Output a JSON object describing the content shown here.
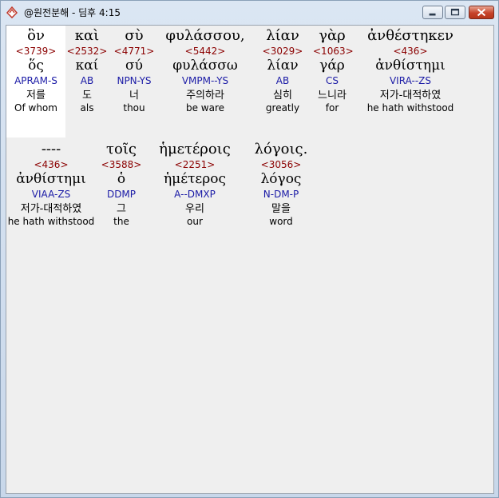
{
  "window": {
    "title": "@원전분해 - 딤후 4:15"
  },
  "rows": [
    {
      "words": [
        {
          "greek": "ὃν",
          "strong": "<3739>",
          "lemma": "ὅς",
          "parse": "APRAM-S",
          "korean": "저를",
          "english": "Of whom"
        },
        {
          "greek": "καὶ",
          "strong": "<2532>",
          "lemma": "καί",
          "parse": "AB",
          "korean": "도",
          "english": "als"
        },
        {
          "greek": "σὺ",
          "strong": "<4771>",
          "lemma": "σύ",
          "parse": "NPN-YS",
          "korean": "너",
          "english": "thou"
        },
        {
          "greek": "φυλάσσου,",
          "strong": "<5442>",
          "lemma": "φυλάσσω",
          "parse": "VMPM--YS",
          "korean": "주의하라",
          "english": "be ware"
        },
        {
          "greek": "λίαν",
          "strong": "<3029>",
          "lemma": "λίαν",
          "parse": "AB",
          "korean": "심히",
          "english": "greatly"
        },
        {
          "greek": "γὰρ",
          "strong": "<1063>",
          "lemma": "γάρ",
          "parse": "CS",
          "korean": "느니라",
          "english": "for"
        },
        {
          "greek": "ἀνθέστηκεν",
          "strong": "<436>",
          "lemma": "ἀνθίστημι",
          "parse": "VIRA--ZS",
          "korean": "저가-대적하였",
          "english": "he hath withstood"
        }
      ]
    },
    {
      "words": [
        {
          "greek": "----",
          "strong": "<436>",
          "lemma": "ἀνθίστημι",
          "parse": "VIAA-ZS",
          "korean": "저가-대적하였",
          "english": "he hath withstood"
        },
        {
          "greek": "τοῖς",
          "strong": "<3588>",
          "lemma": "ὁ",
          "parse": "DDMP",
          "korean": "그",
          "english": "the"
        },
        {
          "greek": "ἡμετέροις",
          "strong": "<2251>",
          "lemma": "ἡμέτερος",
          "parse": "A--DMXP",
          "korean": "우리",
          "english": "our"
        },
        {
          "greek": "λόγοις.",
          "strong": "<3056>",
          "lemma": "λόγος",
          "parse": "N-DM-P",
          "korean": "말을",
          "english": "word"
        }
      ]
    }
  ]
}
